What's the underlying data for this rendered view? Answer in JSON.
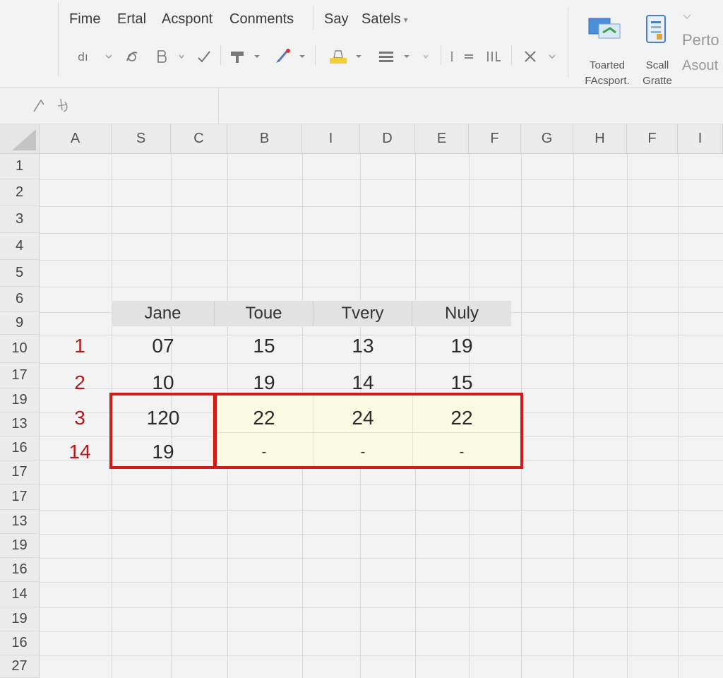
{
  "menu": {
    "items": [
      "Fime",
      "Ertal",
      "Acspont",
      "Conments",
      "Say",
      "Satels"
    ],
    "satels_caret": "▾"
  },
  "ribbon_right": {
    "btn1_line1": "Toarted",
    "btn1_line2": "FAcsport.",
    "btn2_line1": "Scall",
    "btn2_line2": "Gratte",
    "side_line1": "Perto",
    "side_line2": "Asout"
  },
  "formula_bar": {
    "fx_label": "fx",
    "value": ""
  },
  "columns": [
    "A",
    "S",
    "C",
    "B",
    "I",
    "D",
    "E",
    "F",
    "G",
    "H",
    "F",
    "I"
  ],
  "rows": [
    "1",
    "2",
    "3",
    "4",
    "5",
    "6",
    "9",
    "10",
    "17",
    "19",
    "13",
    "16",
    "17",
    "17",
    "13",
    "19",
    "16",
    "14",
    "19",
    "16",
    "27"
  ],
  "table": {
    "headers": [
      "Jane",
      "Toue",
      "Tvery",
      "Nuly"
    ],
    "row_labels": [
      "1",
      "2",
      "3",
      "14"
    ],
    "rows": [
      [
        "07",
        "15",
        "13",
        "19"
      ],
      [
        "10",
        "19",
        "14",
        "15"
      ],
      [
        "120",
        "22",
        "24",
        "22"
      ],
      [
        "19",
        "-",
        "-",
        "-"
      ]
    ]
  },
  "colors": {
    "highlight_border": "#d11a1a",
    "highlight_fill": "#fbfbe3",
    "row_label": "#b01c1c"
  }
}
